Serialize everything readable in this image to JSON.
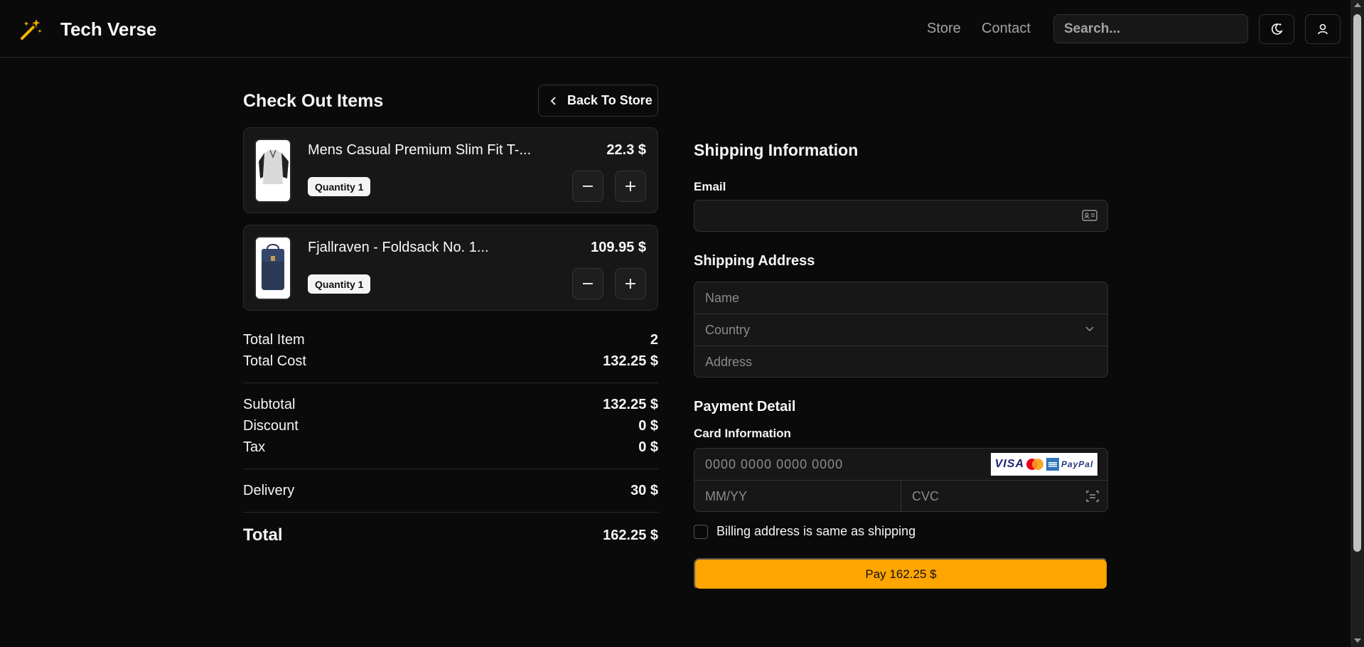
{
  "header": {
    "brand": "Tech Verse",
    "nav": {
      "store": "Store",
      "contact": "Contact"
    },
    "search_placeholder": "Search...",
    "icons": [
      "magic-wand-icon",
      "theme-toggle-icon",
      "user-icon"
    ]
  },
  "checkout": {
    "title": "Check Out Items",
    "back_label": "Back To Store",
    "items": [
      {
        "name": "Mens Casual Premium Slim Fit T-...",
        "quantity": "Quantity 1",
        "price": "22.3 $"
      },
      {
        "name": "Fjallraven - Foldsack No. 1...",
        "quantity": "Quantity 1",
        "price": "109.95 $"
      }
    ],
    "summary": {
      "total_item_label": "Total Item",
      "total_item_value": "2",
      "total_cost_label": "Total Cost",
      "total_cost_value": "132.25 $",
      "subtotal_label": "Subtotal",
      "subtotal_value": "132.25 $",
      "discount_label": "Discount",
      "discount_value": "0 $",
      "tax_label": "Tax",
      "tax_value": "0 $",
      "delivery_label": "Delivery",
      "delivery_value": "30 $",
      "total_label": "Total",
      "total_value": "162.25 $"
    }
  },
  "shipping": {
    "title": "Shipping Information",
    "email_label": "Email",
    "email_value": "",
    "address_title": "Shipping Address",
    "name_placeholder": "Name",
    "country_placeholder": "Country",
    "address_placeholder": "Address"
  },
  "payment": {
    "title": "Payment Detail",
    "card_label": "Card Information",
    "card_placeholder": "0000 0000 0000 0000",
    "exp_placeholder": "MM/YY",
    "cvc_placeholder": "CVC",
    "card_brands": {
      "visa": "VISA",
      "paypal": "PayPal"
    },
    "billing_label": "Billing address is same as shipping",
    "pay_label": "Pay 162.25 $"
  },
  "colors": {
    "accent": "#ffa500",
    "background": "#0a0a0a",
    "surface": "#171717"
  }
}
